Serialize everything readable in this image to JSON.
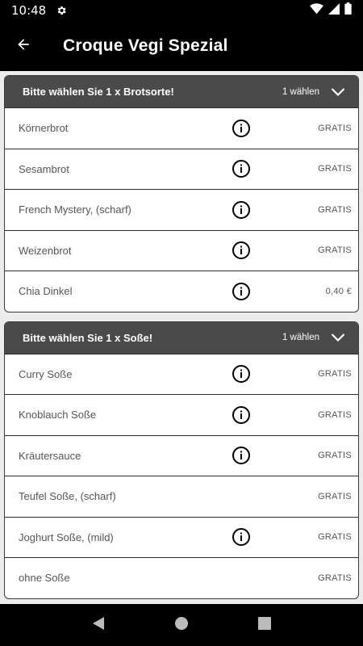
{
  "status": {
    "time": "10:48"
  },
  "appbar": {
    "title": "Croque Vegi Spezial"
  },
  "groups": [
    {
      "title": "Bitte wählen Sie 1 x Brotsorte!",
      "hint": "1 wählen",
      "items": [
        {
          "label": "Körnerbrot",
          "price": "GRATIS",
          "info": true
        },
        {
          "label": "Sesambrot",
          "price": "GRATIS",
          "info": true
        },
        {
          "label": "French Mystery, (scharf)",
          "price": "GRATIS",
          "info": true
        },
        {
          "label": "Weizenbrot",
          "price": "GRATIS",
          "info": true
        },
        {
          "label": "Chia Dinkel",
          "price": "0,40 €",
          "info": true
        }
      ]
    },
    {
      "title": "Bitte wählen Sie 1 x Soße!",
      "hint": "1 wählen",
      "items": [
        {
          "label": "Curry Soße",
          "price": "GRATIS",
          "info": true
        },
        {
          "label": "Knoblauch Soße",
          "price": "GRATIS",
          "info": true
        },
        {
          "label": "Kräutersauce",
          "price": "GRATIS",
          "info": true
        },
        {
          "label": "Teufel Soße, (scharf)",
          "price": "GRATIS",
          "info": false
        },
        {
          "label": "Joghurt Soße, (mild)",
          "price": "GRATIS",
          "info": true
        },
        {
          "label": "ohne Soße",
          "price": "GRATIS",
          "info": false
        }
      ]
    }
  ]
}
